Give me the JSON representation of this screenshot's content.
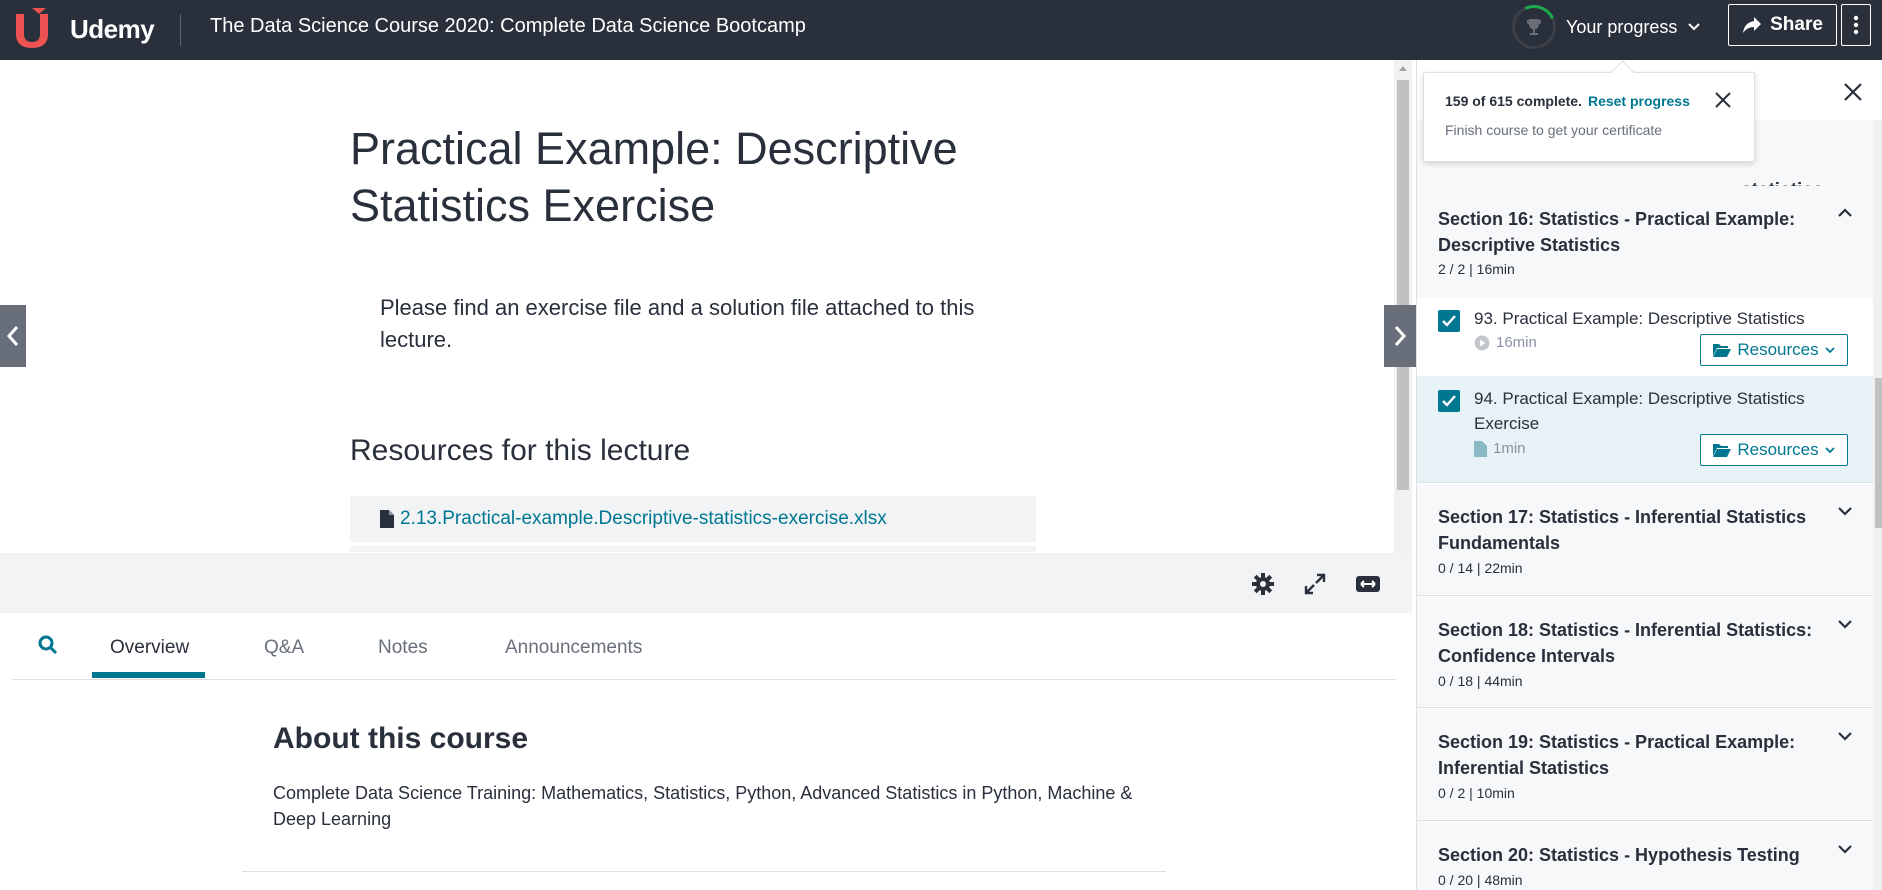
{
  "header": {
    "logo_text": "Udemy",
    "course_title": "The Data Science Course 2020: Complete Data Science Bootcamp",
    "progress_label": "Your progress",
    "share_label": "Share"
  },
  "lecture": {
    "title": "Practical Example: Descriptive Statistics Exercise",
    "body": "Please find an exercise file and a solution file attached to this lecture.",
    "resources_heading": "Resources for this lecture",
    "resource_file": "2.13.Practical-example.Descriptive-statistics-exercise.xlsx"
  },
  "tabs": {
    "overview": "Overview",
    "qa": "Q&A",
    "notes": "Notes",
    "announcements": "Announcements"
  },
  "about": {
    "title": "About this course",
    "description": "Complete Data Science Training: Mathematics, Statistics, Python, Advanced Statistics in Python, Machine & Deep Learning"
  },
  "progress_popover": {
    "complete_text": "159 of 615 complete.",
    "reset_label": "Reset progress",
    "certificate_text": "Finish course to get your certificate"
  },
  "sidebar": {
    "peek_text": "statistics",
    "section16": {
      "title": "Section 16: Statistics - Practical Example: Descriptive Statistics",
      "meta": "2 / 2 | 16min"
    },
    "lesson93": {
      "title": "93. Practical Example: Descriptive Statistics",
      "duration": "16min",
      "resources_label": "Resources",
      "completed": true
    },
    "lesson94": {
      "title": "94. Practical Example: Descriptive Statistics Exercise",
      "duration": "1min",
      "resources_label": "Resources",
      "completed": true
    },
    "section17": {
      "title": "Section 17: Statistics - Inferential Statistics Fundamentals",
      "meta": "0 / 14 | 22min"
    },
    "section18": {
      "title": "Section 18: Statistics - Inferential Statistics: Confidence Intervals",
      "meta": "0 / 18 | 44min"
    },
    "section19": {
      "title": "Section 19: Statistics - Practical Example: Inferential Statistics",
      "meta": "0 / 2 | 10min"
    },
    "section20": {
      "title": "Section 20: Statistics - Hypothesis Testing",
      "meta": "0 / 20 | 48min"
    }
  },
  "colors": {
    "topbar": "#29303b",
    "accent": "#007791",
    "progress_ring": "#1ba94c",
    "logo": "#ec5252"
  }
}
